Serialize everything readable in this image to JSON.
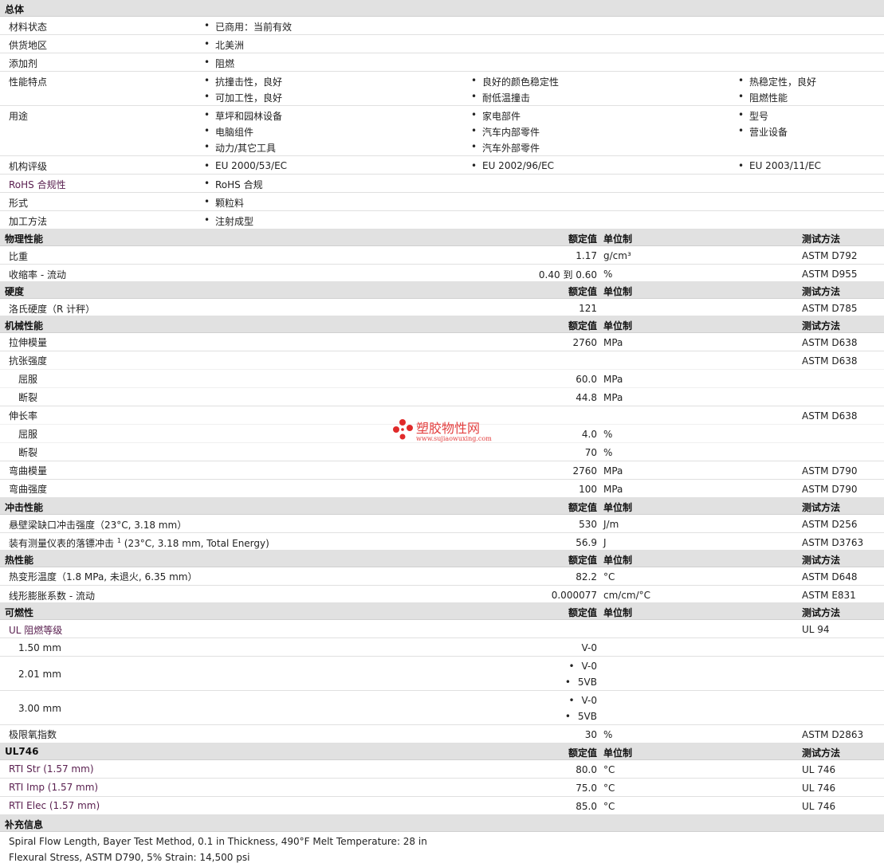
{
  "general": {
    "title": "总体",
    "material_status": {
      "label": "材料状态",
      "value": "已商用：当前有效"
    },
    "availability": {
      "label": "供货地区",
      "value": "北美洲"
    },
    "additive": {
      "label": "添加剂",
      "value": "阻燃"
    },
    "features": {
      "label": "性能特点",
      "items": [
        "抗撞击性，良好",
        "良好的颜色稳定性",
        "热稳定性，良好",
        "可加工性，良好",
        "耐低温撞击",
        "阻燃性能"
      ]
    },
    "uses": {
      "label": "用途",
      "items": [
        "草坪和园林设备",
        "家电部件",
        "型号",
        "电脑组件",
        "汽车内部零件",
        "营业设备",
        "动力/其它工具",
        "汽车外部零件"
      ]
    },
    "agency": {
      "label": "机构评级",
      "items": [
        "EU 2000/53/EC",
        "EU 2002/96/EC",
        "EU 2003/11/EC"
      ]
    },
    "rohs": {
      "label": "RoHS 合规性",
      "value": "RoHS 合规"
    },
    "form": {
      "label": "形式",
      "value": "颗粒料"
    },
    "processing": {
      "label": "加工方法",
      "value": "注射成型"
    }
  },
  "headers": {
    "value": "额定值",
    "unit": "单位制",
    "method": "测试方法"
  },
  "physical": {
    "title": "物理性能",
    "rows": [
      {
        "label": "比重",
        "value": "1.17",
        "unit": "g/cm³",
        "method": "ASTM D792"
      },
      {
        "label": "收缩率  - 流动",
        "value": "0.40 到  0.60",
        "unit": "%",
        "method": "ASTM D955"
      }
    ]
  },
  "hardness": {
    "title": "硬度",
    "rows": [
      {
        "label": "洛氏硬度（R 计秤）",
        "value": "121",
        "unit": "",
        "method": "ASTM D785"
      }
    ]
  },
  "mechanical": {
    "title": "机械性能",
    "tensile_modulus": {
      "label": "拉伸模量",
      "value": "2760",
      "unit": "MPa",
      "method": "ASTM D638"
    },
    "tensile_strength": {
      "label": "抗张强度",
      "method": "ASTM D638"
    },
    "ts_yield": {
      "label": "屈服",
      "value": "60.0",
      "unit": "MPa"
    },
    "ts_break": {
      "label": "断裂",
      "value": "44.8",
      "unit": "MPa"
    },
    "elongation": {
      "label": "伸长率",
      "method": "ASTM D638"
    },
    "el_yield": {
      "label": "屈服",
      "value": "4.0",
      "unit": "%"
    },
    "el_break": {
      "label": "断裂",
      "value": "70",
      "unit": "%"
    },
    "flex_modulus": {
      "label": "弯曲模量",
      "value": "2760",
      "unit": "MPa",
      "method": "ASTM D790"
    },
    "flex_strength": {
      "label": "弯曲强度",
      "value": "100",
      "unit": "MPa",
      "method": "ASTM D790"
    }
  },
  "impact": {
    "title": "冲击性能",
    "izod": {
      "label": "悬壁梁缺口冲击强度（23°C, 3.18 mm）",
      "value": "530",
      "unit": "J/m",
      "method": "ASTM D256"
    },
    "dart_label": "装有测量仪表的落镖冲击",
    "dart_sup": "1",
    "dart_cond": "(23°C, 3.18 mm, Total Energy)",
    "dart": {
      "value": "56.9",
      "unit": "J",
      "method": "ASTM D3763"
    }
  },
  "thermal": {
    "title": "热性能",
    "rows": [
      {
        "label": "热变形温度（1.8 MPa, 未退火, 6.35 mm）",
        "value": "82.2",
        "unit": "°C",
        "method": "ASTM D648"
      },
      {
        "label": "线形膨胀系数  - 流动",
        "value": "0.000077",
        "unit": "cm/cm/°C",
        "method": "ASTM E831"
      }
    ]
  },
  "flammability": {
    "title": "可燃性",
    "ul": {
      "label": "UL 阻燃等级",
      "method": "UL 94"
    },
    "t150": {
      "label": "1.50 mm",
      "value": "V-0"
    },
    "t201": {
      "label": "2.01 mm",
      "v1": "V-0",
      "v2": "5VB"
    },
    "t300": {
      "label": "3.00 mm",
      "v1": "V-0",
      "v2": "5VB"
    },
    "loi": {
      "label": "极限氧指数",
      "value": "30",
      "unit": "%",
      "method": "ASTM D2863"
    }
  },
  "ul746": {
    "title": "UL746",
    "rows": [
      {
        "label": "RTI Str (1.57 mm)",
        "value": "80.0",
        "unit": "°C",
        "method": "UL 746"
      },
      {
        "label": "RTI Imp (1.57 mm)",
        "value": "75.0",
        "unit": "°C",
        "method": "UL 746"
      },
      {
        "label": "RTI Elec (1.57 mm)",
        "value": "85.0",
        "unit": "°C",
        "method": "UL 746"
      }
    ]
  },
  "supplement": {
    "title": "补充信息",
    "lines": [
      "Spiral Flow Length, Bayer Test Method, 0.1 in Thickness, 490°F Melt Temperature: 28 in",
      "Flexural Stress, ASTM D790, 5% Strain: 14,500 psi"
    ]
  },
  "watermark": {
    "text": "塑胶物性网",
    "url": "www.sujiaowuxing.com",
    "color": "#e34040"
  }
}
